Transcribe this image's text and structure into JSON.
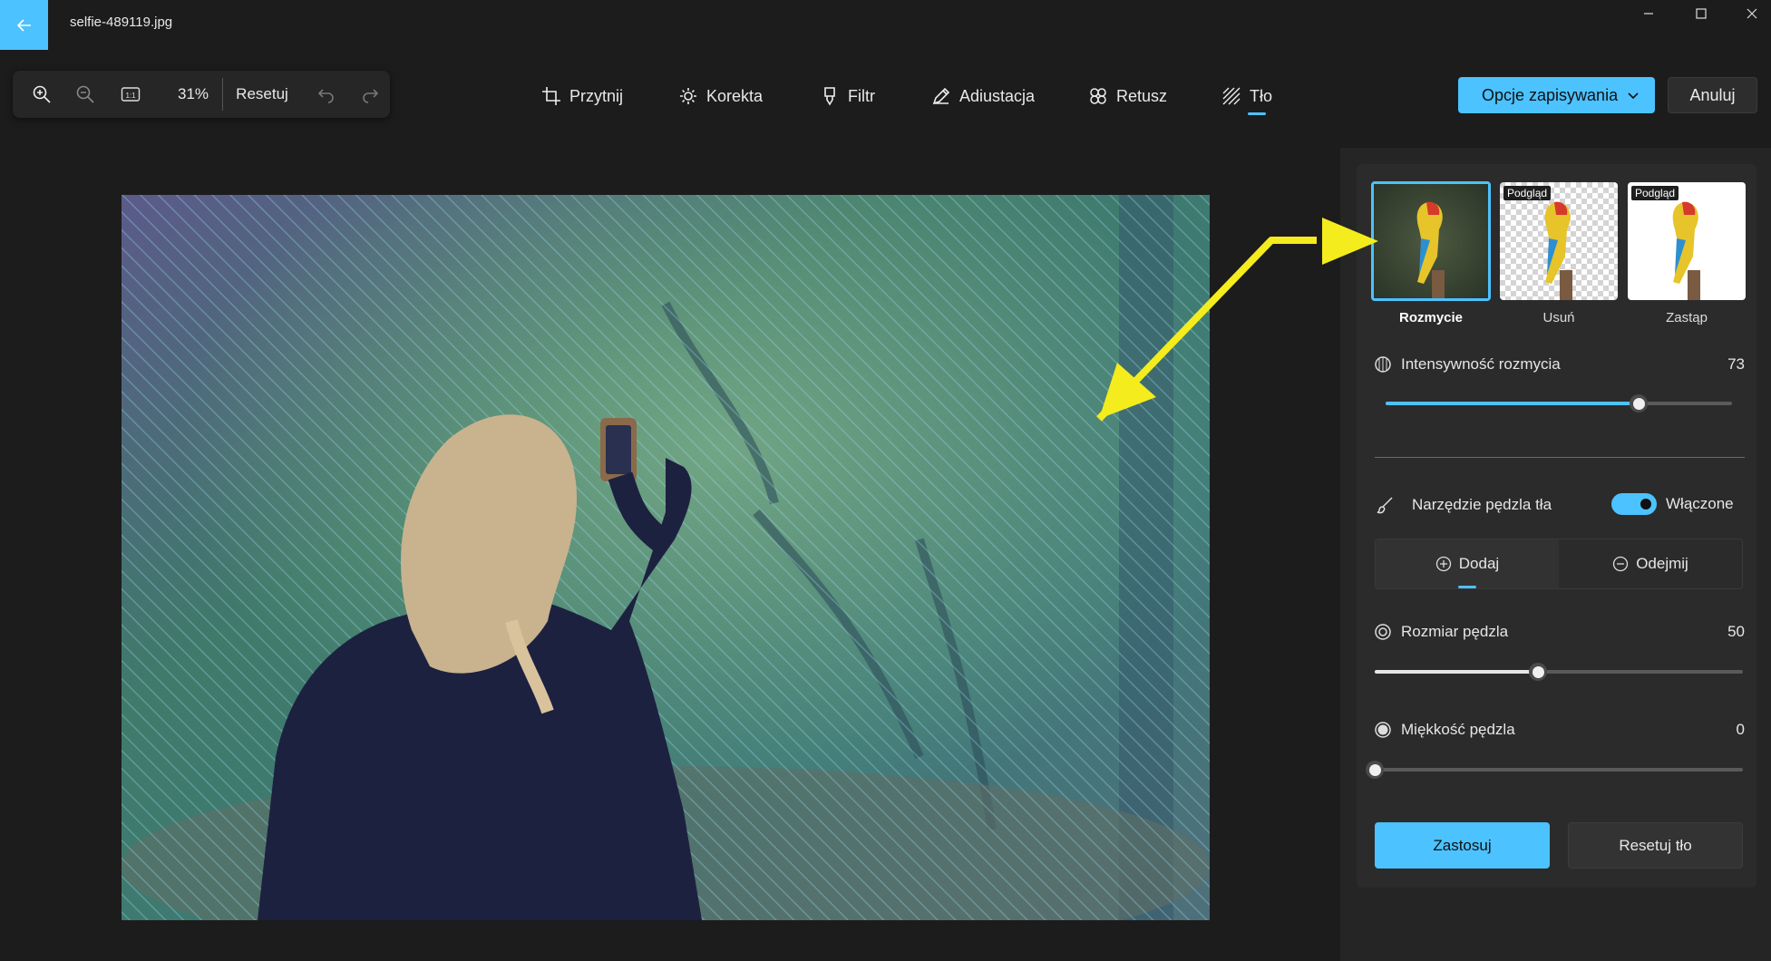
{
  "window": {
    "title": "selfie-489119.jpg"
  },
  "zoom_toolbar": {
    "zoom_level": "31%",
    "reset_label": "Resetuj",
    "fit_label": "1:1"
  },
  "tabs": [
    {
      "label": "Przytnij",
      "icon": "crop-icon"
    },
    {
      "label": "Korekta",
      "icon": "brightness-icon"
    },
    {
      "label": "Filtr",
      "icon": "filter-icon"
    },
    {
      "label": "Adiustacja",
      "icon": "pencil-icon"
    },
    {
      "label": "Retusz",
      "icon": "retouch-icon"
    },
    {
      "label": "Tło",
      "icon": "background-icon",
      "selected": true
    }
  ],
  "actions": {
    "save_options_label": "Opcje zapisywania",
    "cancel_label": "Anuluj"
  },
  "background_panel": {
    "modes": [
      {
        "label": "Rozmycie",
        "selected": true,
        "badge": ""
      },
      {
        "label": "Usuń",
        "selected": false,
        "badge": "Podgląd"
      },
      {
        "label": "Zastąp",
        "selected": false,
        "badge": "Podgląd"
      }
    ],
    "blur_intensity": {
      "label": "Intensywność rozmycia",
      "value": 73
    },
    "brush_tool": {
      "label": "Narzędzie pędzla tła",
      "state_label": "Włączone",
      "on": true
    },
    "add_label": "Dodaj",
    "subtract_label": "Odejmij",
    "brush_size": {
      "label": "Rozmiar pędzla",
      "value": 50
    },
    "brush_softness": {
      "label": "Miękkość pędzla",
      "value": 0
    },
    "apply_label": "Zastosuj",
    "reset_bg_label": "Resetuj tło"
  },
  "colors": {
    "accent": "#4cc2ff",
    "background": "#1c1c1c",
    "panel": "#2b2b2b"
  }
}
